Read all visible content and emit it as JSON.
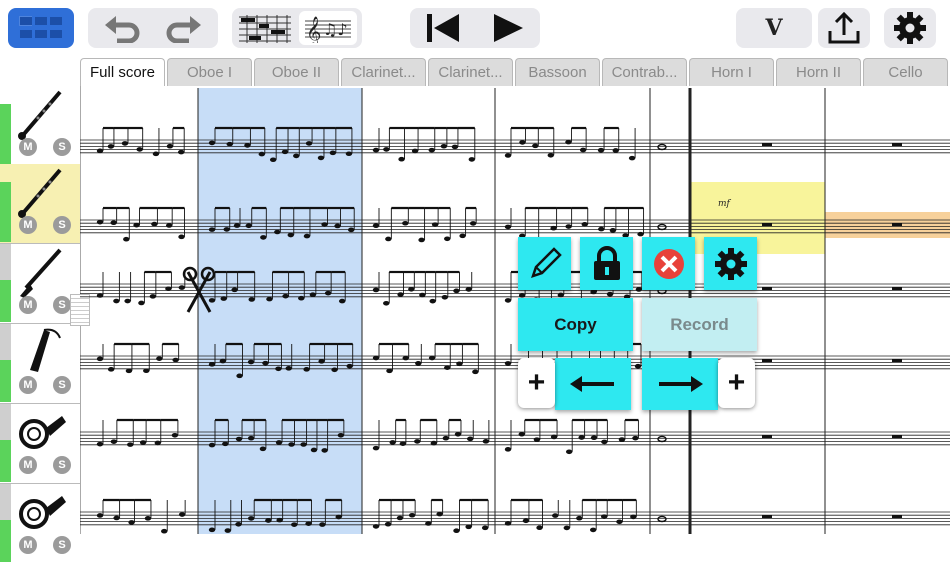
{
  "toolbar": {
    "version_label": "V",
    "buttons": [
      "grid-view-icon",
      "undo-icon",
      "redo-icon",
      "piano-roll-icon",
      "notation-icon",
      "skip-back-icon",
      "play-icon",
      "version-button",
      "export-icon",
      "settings-icon"
    ]
  },
  "tabs": [
    "Full score",
    "Oboe I",
    "Oboe II",
    "Clarinet...",
    "Clarinet...",
    "Bassoon",
    "Contrab...",
    "Horn I",
    "Horn II",
    "Cello"
  ],
  "active_tab": 0,
  "instruments": [
    {
      "icon": "oboe-icon",
      "mute": "M",
      "solo": "S",
      "selected": false
    },
    {
      "icon": "oboe-icon",
      "mute": "M",
      "solo": "S",
      "selected": true
    },
    {
      "icon": "clarinet-icon",
      "mute": "M",
      "solo": "S",
      "selected": false
    },
    {
      "icon": "bassoon-icon",
      "mute": "M",
      "solo": "S",
      "selected": false
    },
    {
      "icon": "horn-icon",
      "mute": "M",
      "solo": "S",
      "selected": false
    },
    {
      "icon": "horn-icon",
      "mute": "M",
      "solo": "S",
      "selected": false
    }
  ],
  "score": {
    "dynamic_marking": "mf",
    "highlight_color": "#c7ddf7",
    "selection_color": "#f5f07a"
  },
  "context_menu": {
    "copy_label": "Copy",
    "record_label": "Record",
    "icons": [
      "pencil-icon",
      "lock-icon",
      "delete-icon",
      "gear-icon",
      "plus-left-icon",
      "arrow-left-icon",
      "arrow-right-icon",
      "plus-right-icon"
    ],
    "accent_color": "#2ee8f0"
  }
}
